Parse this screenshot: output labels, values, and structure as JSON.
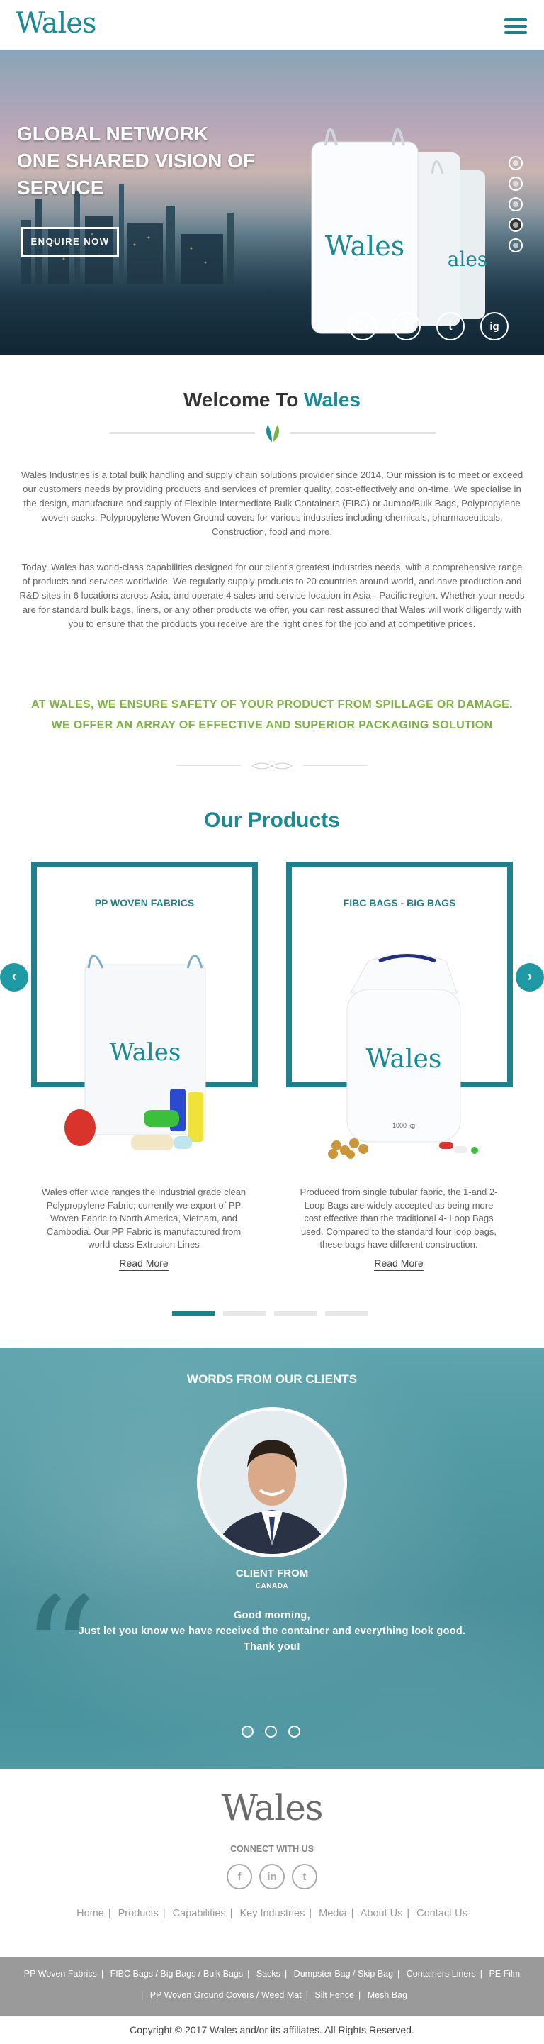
{
  "header": {
    "logo_text": "Wales",
    "menu_icon": "hamburger-icon"
  },
  "hero": {
    "title_lines": [
      "GLOBAL NETWORK",
      "ONE SHARED VISION OF",
      "SERVICE"
    ],
    "enquire_label": "ENQUIRE NOW",
    "bag_brand": "Wales",
    "bag_brand_2": "ales",
    "slide_indicator_count": 5,
    "active_slide": 4,
    "social": [
      "G+",
      "f",
      "t",
      "ig"
    ]
  },
  "welcome": {
    "title_prefix": "Welcome To",
    "title_brand": "Wales",
    "paragraph1": "Wales Industries is a total bulk handling and supply chain solutions provider since 2014, Our mission is to meet or exceed our customers needs by providing products and services of premier quality, cost-effectively and on-time. We specialise in the design, manufacture and supply of Flexible Intermediate Bulk Containers (FIBC) or Jumbo/Bulk Bags, Polypropylene woven sacks, Polypropylene Woven Ground covers for various industries including chemicals, pharmaceuticals, Construction, food and more.",
    "paragraph2": "Today, Wales has world-class capabilities designed for our client's greatest industries needs, with a comprehensive range of products and services worldwide. We regularly supply products to 20 countries around world, and have production and R&D sites in 6 locations across Asia, and operate 4 sales and service location in Asia - Pacific region. Whether your needs are for standard bulk bags, liners, or any other products we offer, you can rest assured that Wales will work diligently with you to ensure that the products you receive are the right ones for the job and at competitive prices.",
    "highlight1": "AT WALES, WE ENSURE SAFETY OF YOUR PRODUCT FROM SPILLAGE OR DAMAGE.",
    "highlight2": "WE OFFER AN ARRAY OF EFFECTIVE AND SUPERIOR PACKAGING SOLUTION"
  },
  "products": {
    "title": "Our Products",
    "items": [
      {
        "name": "PP WOVEN FABRICS",
        "description": "Wales offer wide ranges the Industrial grade clean Polypropylene Fabric; currently we export of PP Woven Fabric to North America, Vietnam, and Cambodia. Our PP Fabric is manufactured from world-class Extrusion Lines",
        "link": "Read More",
        "bag_brand": "Wales"
      },
      {
        "name": "FIBC BAGS - BIG BAGS",
        "description": "Produced from single tubular fabric, the 1-and 2-Loop Bags are widely accepted as being more cost effective than the traditional 4- Loop Bags used. Compared to the standard four loop bags, these bags have different construction.",
        "link": "Read More",
        "bag_brand": "Wales",
        "bag_weight": "1000 kg"
      }
    ],
    "prev_label": "‹",
    "next_label": "›",
    "pager_count": 4,
    "pager_active": 1
  },
  "testimonials": {
    "title": "WORDS FROM OUR CLIENTS",
    "client": "CLIENT FROM",
    "country": "CANADA",
    "quote_lines": [
      "Good morning,",
      "Just let you know we have received the container and everything look good.",
      "Thank you!"
    ],
    "quote_glyph": "“",
    "dots_count": 3
  },
  "footer": {
    "logo_text": "Wales",
    "connect": "CONNECT WITH US",
    "social": [
      "f",
      "in",
      "t"
    ],
    "nav": [
      "Home",
      "Products",
      "Capabilities",
      "Key Industries",
      "Media",
      "About Us",
      "Contact Us"
    ],
    "product_links_row1": [
      "PP Woven Fabrics",
      "FIBC Bags / Big Bags / Bulk Bags",
      "Sacks",
      "Dumpster Bag / Skip Bag",
      "Containers Liners",
      "PE Film"
    ],
    "product_links_row2": [
      "PP Woven Ground Covers / Weed Mat",
      "Silt Fence",
      "Mesh Bag"
    ],
    "copyright": "Copyright © 2017 Wales and/or its affiliates. All Rights Reserved."
  },
  "colors": {
    "brand": "#1a8a95",
    "accent_green": "#7cb342",
    "frame": "#1f7f8a",
    "footer_bar": "#9a9a9a"
  }
}
